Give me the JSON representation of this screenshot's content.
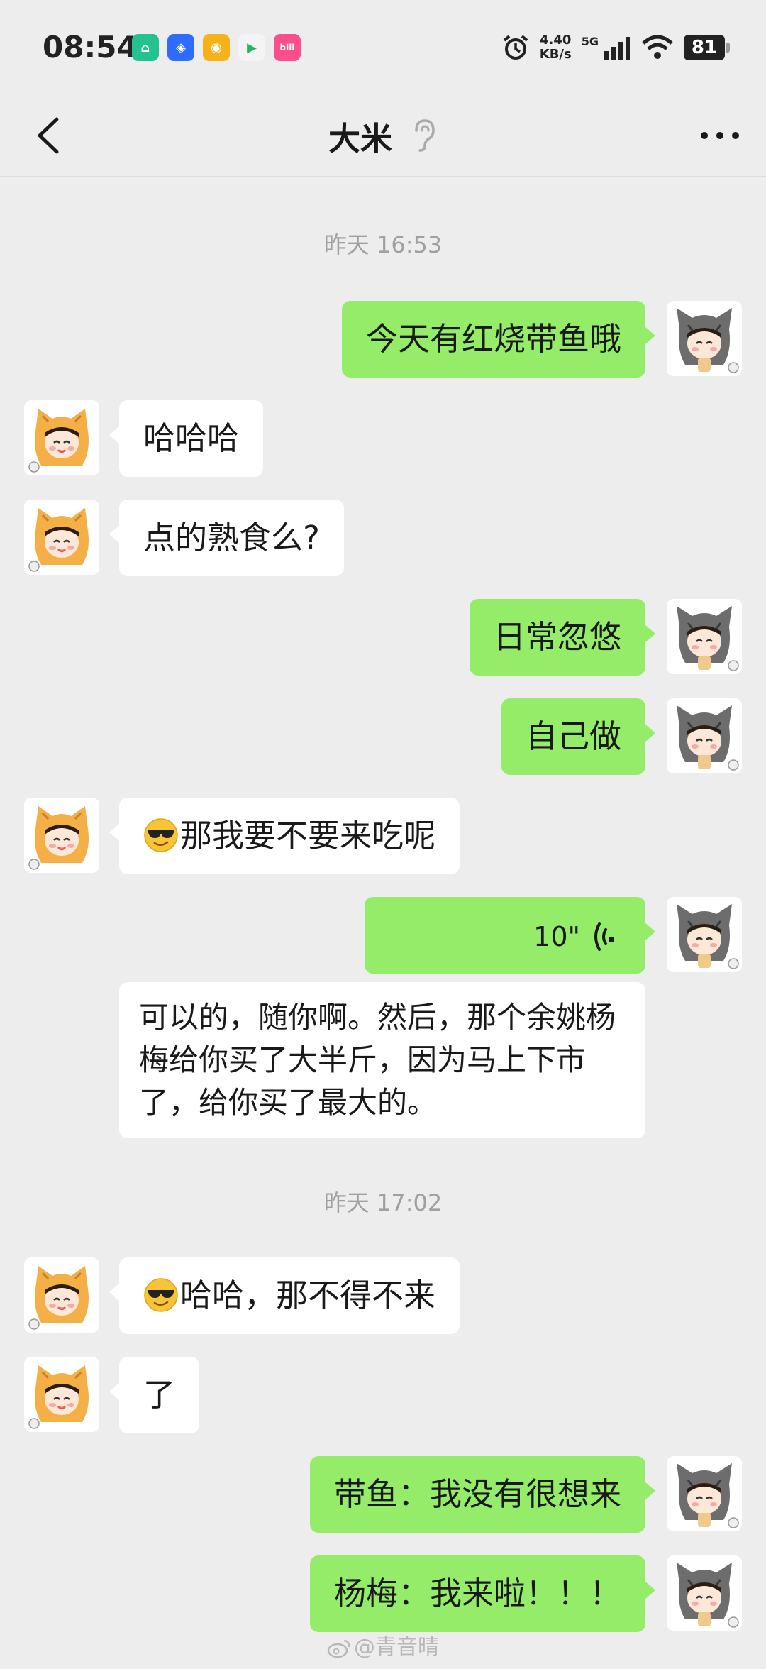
{
  "status_bar": {
    "time": "08:54",
    "net_speed_value": "4.40",
    "net_speed_unit": "KB/s",
    "network": "5G",
    "battery": "81",
    "icons": [
      "mi-home-icon",
      "bluetooth-app-icon",
      "weibo-icon",
      "video-play-icon",
      "bilibili-icon",
      "alarm-icon",
      "signal-icon",
      "wifi-icon",
      "battery-icon"
    ]
  },
  "header": {
    "title": "大米",
    "back_icon": "chevron-left-icon",
    "earpiece_icon": "ear-icon",
    "more_icon": "more-dots-icon"
  },
  "colors": {
    "background": "#ededed",
    "my_bubble": "#95ec69",
    "their_bubble": "#ffffff",
    "timestamp": "#a0a0a0"
  },
  "chat": {
    "timestamp_1": "昨天 16:53",
    "timestamp_2": "昨天 17:02",
    "messages": [
      {
        "sender": "me",
        "text": "今天有红烧带鱼哦"
      },
      {
        "sender": "them",
        "text": "哈哈哈"
      },
      {
        "sender": "them",
        "text": "点的熟食么?"
      },
      {
        "sender": "me",
        "text": "日常忽悠"
      },
      {
        "sender": "me",
        "text": "自己做"
      },
      {
        "sender": "them",
        "emoji": "sunglasses-emoji",
        "text": "那我要不要来吃呢"
      },
      {
        "sender": "me",
        "type": "voice",
        "duration": "10\""
      },
      {
        "sender": "me",
        "type": "voice-transcript",
        "text": "可以的，随你啊。然后，那个余姚杨梅给你买了大半斤，因为马上下市了，给你买了最大的。"
      },
      {
        "sender": "them",
        "emoji": "sunglasses-emoji",
        "text": "哈哈，那不得不来"
      },
      {
        "sender": "them",
        "text": "了"
      },
      {
        "sender": "me",
        "text": "带鱼：我没有很想来"
      },
      {
        "sender": "me",
        "text": "杨梅：我来啦！！！"
      }
    ]
  },
  "watermark": "@青音晴"
}
